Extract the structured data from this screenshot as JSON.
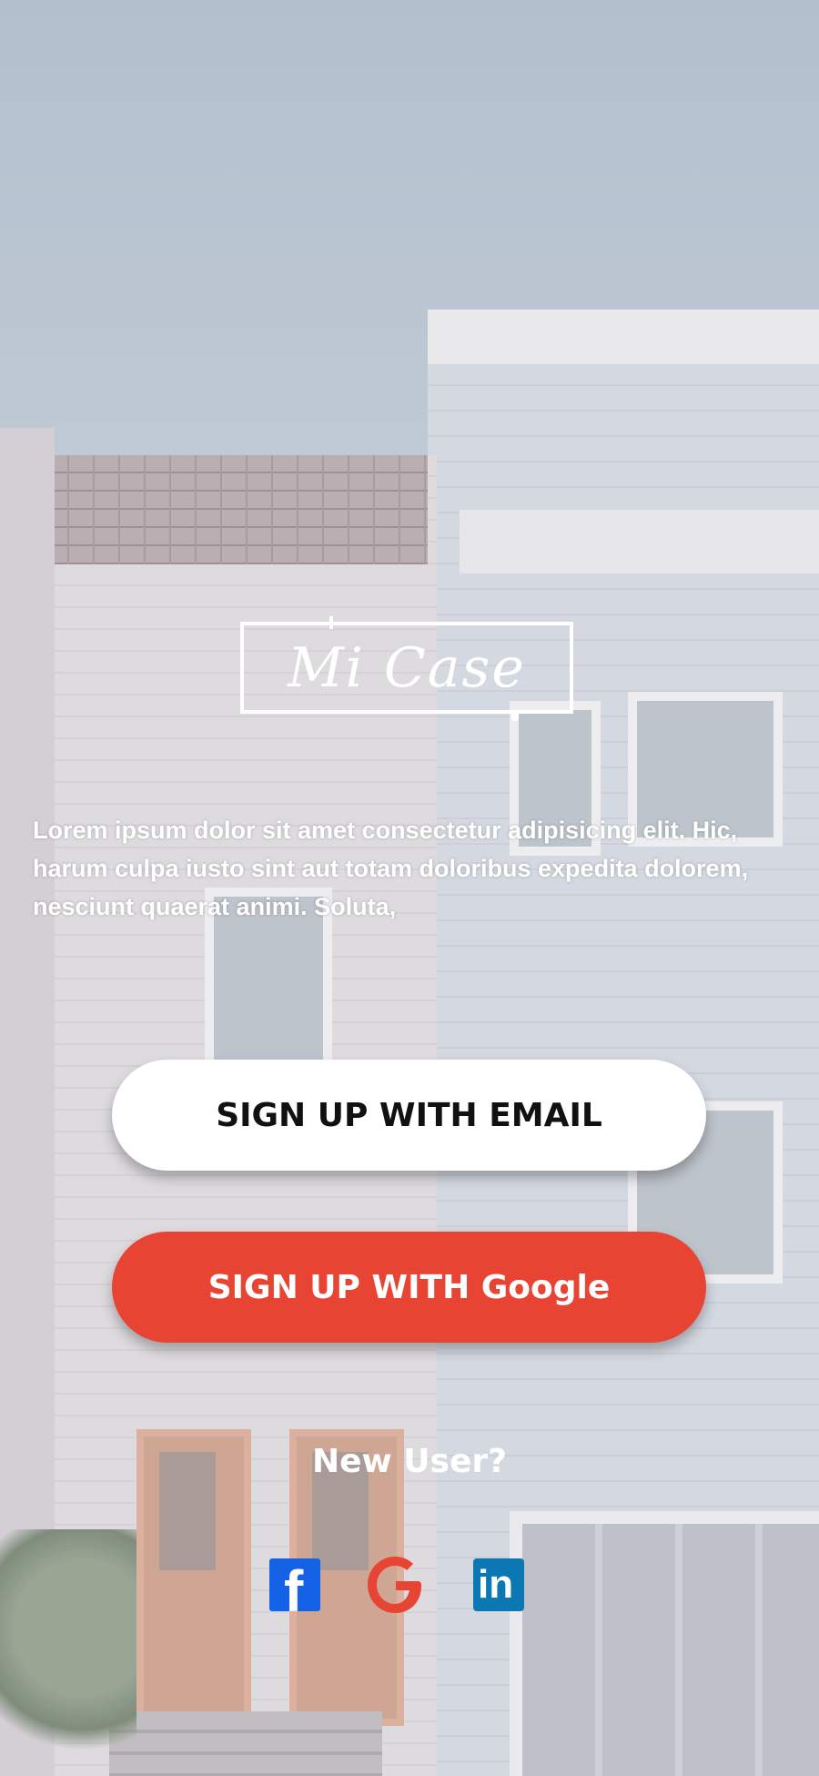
{
  "brand": {
    "logo_text": "Mi Case"
  },
  "intro_text": "Lorem ipsum dolor sit amet consectetur adipisicing elit. Hic, harum culpa iusto sint aut totam doloribus expedita dolorem, nesciunt quaerat animi. Soluta,",
  "buttons": {
    "email_label": "SIGN UP WITH EMAIL",
    "google_label": "SIGN UP WITH Google"
  },
  "new_user_text": "New User?",
  "social": {
    "facebook_glyph": "f",
    "linkedin_glyph": "in",
    "icons": [
      "facebook-icon",
      "google-icon",
      "linkedin-icon"
    ]
  },
  "colors": {
    "google_button": "#e84433",
    "email_button": "#ffffff",
    "facebook": "#1462e6",
    "linkedin": "#0b78b4"
  }
}
